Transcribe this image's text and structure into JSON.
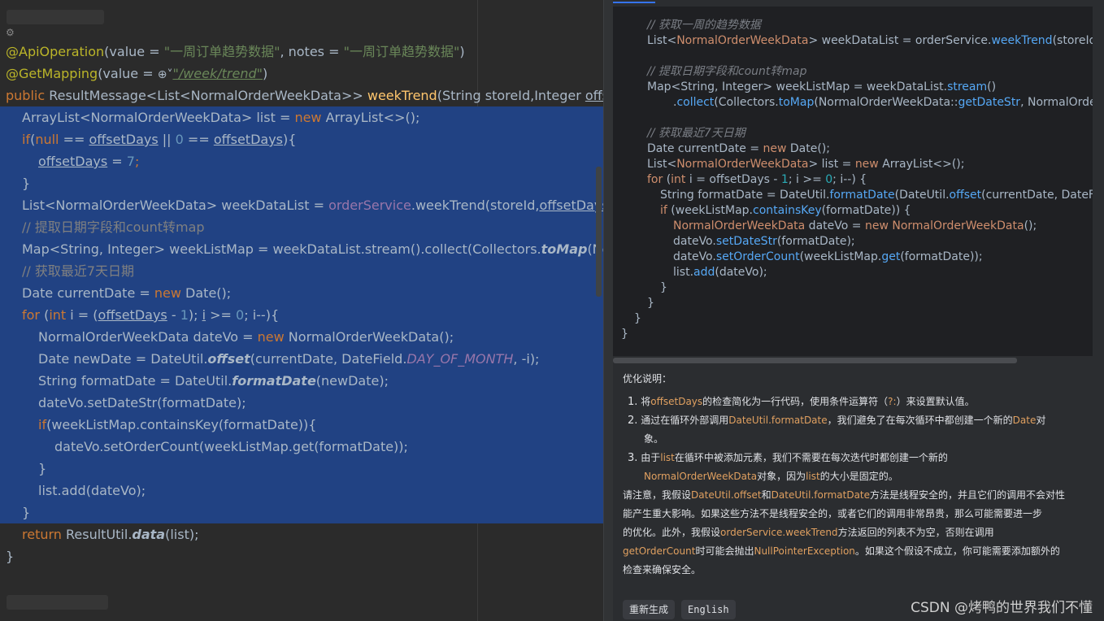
{
  "editor": {
    "line_ann1": {
      "a": "@ApiOperation",
      "b": "(value = ",
      "s1": "\"一周订单趋势数据\"",
      "c": ", notes = ",
      "s2": "\"一周订单趋势数据\"",
      "d": ")"
    },
    "line_ann2": {
      "a": "@GetMapping",
      "b": "(value = ",
      "s": "\"/week/trend\"",
      "c": ")"
    },
    "line_sig": {
      "kw": "public",
      "t1": " ResultMessage<List<NormalOrderWeekData>> ",
      "fn": "weekTrend",
      "t2": "(String storeId,Integer ",
      "p": "offsetD"
    },
    "l1": {
      "t1": "ArrayList<NormalOrderWeekData> list = ",
      "kw": "new",
      "t2": " ArrayList<>();"
    },
    "l2": {
      "kw": "if",
      "t1": "(",
      "kw2": "null",
      "t2": " == ",
      "v1": "offsetDays",
      "t3": " || ",
      "n": "0",
      "t4": " == ",
      "v2": "offsetDays",
      "t5": "){"
    },
    "l3": {
      "v": "offsetDays",
      "t": " = ",
      "n": "7",
      "e": ";"
    },
    "l4": "}",
    "l5": {
      "t1": "List<NormalOrderWeekData> weekDataList = ",
      "m": "orderService",
      "t2": ".weekTrend(storeId,",
      "v": "offsetDays",
      "t3": ");"
    },
    "l6": "// 提取日期字段和count转map",
    "l7": {
      "t1": "Map<String, Integer> weekListMap = weekDataList.stream().collect(Collectors.",
      "it": "toMap",
      "t2": "(Norma"
    },
    "l8": "// 获取最近7天日期",
    "l9": {
      "t1": "Date currentDate = ",
      "kw": "new",
      "t2": " Date();"
    },
    "l10": {
      "kw": "for",
      "t1": " (",
      "kw2": "int",
      "t2": " i = (",
      "v": "offsetDays",
      "t3": " - ",
      "n1": "1",
      "t4": "); ",
      "i": "i",
      "t5": " >= ",
      "n2": "0",
      "t6": "; i--){"
    },
    "l11": {
      "t1": "NormalOrderWeekData dateVo = ",
      "kw": "new",
      "t2": " NormalOrderWeekData();"
    },
    "l12": {
      "t1": "Date newDate = DateUtil.",
      "it": "offset",
      "t2": "(currentDate, DateField.",
      "f": "DAY_OF_MONTH",
      "t3": ", -i);"
    },
    "l13": {
      "t1": "String formatDate = DateUtil.",
      "it": "formatDate",
      "t2": "(newDate);"
    },
    "l14": "dateVo.setDateStr(formatDate);",
    "l15": {
      "kw": "if",
      "t": "(weekListMap.containsKey(formatDate)){"
    },
    "l16": "dateVo.setOrderCount(weekListMap.get(formatDate));",
    "l17": "}",
    "l18": "list.add(dateVo);",
    "l19": "}",
    "l20": {
      "kw": "return",
      "t1": " ResultUtil.",
      "it": "data",
      "t2": "(list);"
    },
    "l21": "}"
  },
  "ai_code": {
    "c1": "// 获取一周的趋势数据",
    "c2": {
      "t1": "List<",
      "cls": "NormalOrderWeekData",
      "t2": "> weekDataList = orderService.",
      "call": "weekTrend",
      "t3": "(storeId, off"
    },
    "c3": "// 提取日期字段和count转map",
    "c4": {
      "t1": "Map<String, Integer> weekListMap = weekDataList.",
      "call": "stream",
      "t2": "()"
    },
    "c5": {
      "t1": ".",
      "call": "collect",
      "t2": "(Collectors.",
      "call2": "toMap",
      "t3": "(NormalOrderWeekData::",
      "call3": "getDateStr",
      "t4": ", NormalOrderW"
    },
    "c6": "// 获取最近7天日期",
    "c7": {
      "t1": "Date currentDate = ",
      "kw": "new",
      "t2": " Date();"
    },
    "c8": {
      "t1": "List<",
      "cls": "NormalOrderWeekData",
      "t2": "> list = ",
      "kw": "new",
      "t3": " ArrayList<>();"
    },
    "c9": {
      "kw": "for",
      "t1": " (",
      "kw2": "int",
      "t2": " i = offsetDays - ",
      "n1": "1",
      "t3": "; i >= ",
      "n2": "0",
      "t4": "; i--) {"
    },
    "c10": {
      "t1": "String formatDate = DateUtil.",
      "call": "formatDate",
      "t2": "(DateUtil.",
      "call2": "offset",
      "t3": "(currentDate, DateField"
    },
    "c11": {
      "kw": "if",
      "t1": " (weekListMap.",
      "call": "containsKey",
      "t2": "(formatDate)) {"
    },
    "c12": {
      "cls": "NormalOrderWeekData",
      "t1": " dateVo = ",
      "kw": "new",
      "t2": " ",
      "cls2": "NormalOrderWeekData",
      "t3": "();"
    },
    "c13": {
      "t1": "dateVo.",
      "call": "setDateStr",
      "t2": "(formatDate);"
    },
    "c14": {
      "t1": "dateVo.",
      "call": "setOrderCount",
      "t2": "(weekListMap.",
      "call2": "get",
      "t3": "(formatDate));"
    },
    "c15": {
      "t1": "list.",
      "call": "add",
      "t2": "(dateVo);"
    },
    "c16": "}",
    "c17": "}",
    "c18": "}",
    "c19": "}"
  },
  "explanation": {
    "title": "优化说明：",
    "i1": {
      "n": "1.",
      "t1": "将",
      "h1": "offsetDays",
      "t2": "的检查简化为一行代码，使用条件运算符（",
      "h2": "?:",
      "t3": "）来设置默认值。"
    },
    "i2a": {
      "n": "2.",
      "t1": "通过在循环外部调用",
      "h1": "DateUtil.formatDate",
      "t2": "，我们避免了在每次循环中都创建一个新的",
      "h2": "Date",
      "t3": "对"
    },
    "i2b": "象。",
    "i3a": {
      "n": "3.",
      "t1": "由于",
      "h1": "list",
      "t2": "在循环中被添加元素，我们不需要在每次迭代时都创建一个新的"
    },
    "i3b": {
      "h1": "NormalOrderWeekData",
      "t1": "对象，因为",
      "h2": "list",
      "t2": "的大小是固定的。"
    },
    "p1": {
      "t1": "请注意，我假设",
      "h1": "DateUtil.offset",
      "t2": "和",
      "h2": "DateUtil.formatDate",
      "t3": "方法是线程安全的，并且它们的调用不会对性"
    },
    "p2": "能产生重大影响。如果这些方法不是线程安全的，或者它们的调用非常昂贵，那么可能需要进一步",
    "p3": {
      "t1": "的优化。此外，我假设",
      "h1": "orderService.weekTrend",
      "t2": "方法返回的列表不为空，否则在调用"
    },
    "p4": {
      "h1": "getOrderCount",
      "t1": "时可能会抛出",
      "h2": "NullPointerException",
      "t2": "。如果这个假设不成立，你可能需要添加额外的"
    },
    "p5": "检查来确保安全。"
  },
  "buttons": {
    "regenerate": "重新生成",
    "english": "English"
  },
  "watermark": "CSDN @烤鸭的世界我们不懂"
}
